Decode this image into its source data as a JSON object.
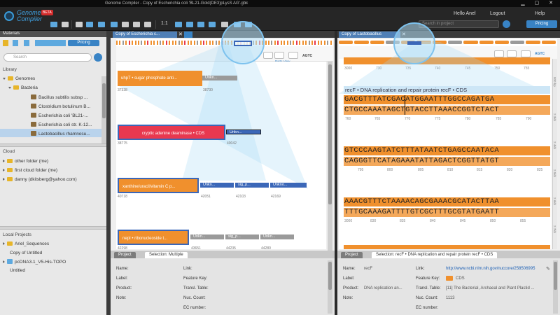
{
  "window": {
    "title": "Genome Compiler - Copy of Escherichia coli 'BL21-Gold(DE3)pLysS AG'.gbk",
    "controls": "▁ ▢ ✕"
  },
  "brand": {
    "name_line1": "Genome",
    "name_line2": "Compiler",
    "badge": "BETA"
  },
  "toolbar": {
    "zoom": "1:1",
    "search_placeholder": "Search in project",
    "pricing": "Pricing"
  },
  "user": {
    "hello": "Hello Anel",
    "logout": "Logout",
    "help": "Help"
  },
  "left": {
    "materials_title": "Materials",
    "pricing": "Pricing",
    "search_placeholder": "Search",
    "library": "Library",
    "genomes": "Genomes",
    "bacteria": "Bacteria",
    "genome_items": [
      "Bacillus subtilis subsp ...",
      "Clostridium botulinum B...",
      "Escherichia coli 'BL21-...",
      "Escherichia coli str. K-12...",
      "Lactobacillus rhamnosu..."
    ],
    "cloud": "Cloud",
    "cloud_items": [
      "other folder (me)",
      "first cloud folder (me)",
      "danny (dkitsberg@yahoo.com)"
    ],
    "local_title": "Local Projects",
    "local_items": [
      "Ariel_Sequences",
      "Copy of Untitled",
      "pcDNA3.1_V5-His-TOPO",
      "Untitled"
    ]
  },
  "editor1": {
    "tab": "Copy of Escherichia c...",
    "parts_view": "Parts View",
    "agtc": "AGTC",
    "rows": [
      {
        "main": "uhpT • sugar phosphate anti...",
        "main_pos": "37338",
        "unk": "Unkn...",
        "unk_pos": "38730"
      },
      {
        "main": "cryptic adenine deaminase • CDS",
        "main_pos": "38775",
        "unk": "Unkn...",
        "unk_pos": "40042"
      },
      {
        "main": "xanthine/uracil/vitamin C p...",
        "main_pos": "40718",
        "unks": [
          "Unkn...",
          "sig_p...",
          "Unkno..."
        ],
        "unk_pos": [
          "42051",
          "42103",
          "42169"
        ]
      },
      {
        "main": "nepI • ribonucleoside t...",
        "main_pos": "42298",
        "unks": [
          "Unkn...",
          "sig_p...",
          "Unkn..."
        ],
        "unk_pos": [
          "43651",
          "44235",
          "44280"
        ]
      }
    ],
    "prop_tabs": [
      "Project",
      "Selection: Multiple"
    ],
    "props_left": [
      "Name:",
      "Label:",
      "Product:",
      "Note:"
    ],
    "props_right": [
      "Link:",
      "Feature Key:",
      "Transl. Table:",
      "Nuc. Count:",
      "EC number:"
    ]
  },
  "editor2": {
    "tab": "Copy of Lactobacillus",
    "dna_view": "DNA View",
    "agtc": "AGTC",
    "top_nums": [
      "3000",
      "730",
      "735",
      "740",
      "745",
      "750",
      "755"
    ],
    "feature_label": "recF • DNA replication and repair protein recF • CDS",
    "seq": [
      {
        "top": "GACGTTTATCGACATGGAATTTGGCCAGATGA",
        "bot": "CTGCCAAATAGCTGTACCTTAAACCGGTCTACT",
        "nums": [
          "760",
          "765",
          "770",
          "775",
          "780",
          "785",
          "790"
        ]
      },
      {
        "top": "GTCCCAAGTATCTTTATAATCTGAGCCAATACA",
        "bot": "CAGGGTTCATAGAAATATTAGACTCGGTTATGT",
        "nums": [
          "795",
          "800",
          "805",
          "810",
          "815",
          "820",
          "825"
        ]
      },
      {
        "top": "AAACGTTTCTAAAACAGCGAAACGCATACTTAA",
        "bot": "TTTGCAAAGATTTTGTCGCTTTGCGTATGAATT",
        "nums": [
          "3000",
          "830",
          "835",
          "840",
          "845",
          "850",
          "855"
        ]
      }
    ],
    "ruler": [
      "800 bp",
      "2.3kb",
      "2.4kb",
      "2.5kb",
      "2.6kb",
      "2.7kb",
      "2.8kb"
    ],
    "prop_tabs": [
      "Project",
      "Selection: recF • DNA replication and repair protein recF • CDS"
    ],
    "props": {
      "name": "Name:",
      "name_val": "recF",
      "label": "Label:",
      "product": "Product:",
      "product_val": "DNA replication an...",
      "note": "Note:",
      "link": "Link:",
      "link_val": "http://www.ncbi.nlm.nih.gov/nuccore/258506995",
      "feature_key": "Feature Key:",
      "feature_key_val": "CDS",
      "transl": "Transl. Table:",
      "transl_val": "[11] The Bacterial, Archaeal and Plant Plastid ...",
      "nuc": "Nuc. Count:",
      "nuc_val": "1113",
      "ec": "EC number:"
    }
  },
  "colors": {
    "orange": "#f0902d",
    "blue": "#3b67b8",
    "red": "#e8384f",
    "accent": "#3883c5"
  }
}
